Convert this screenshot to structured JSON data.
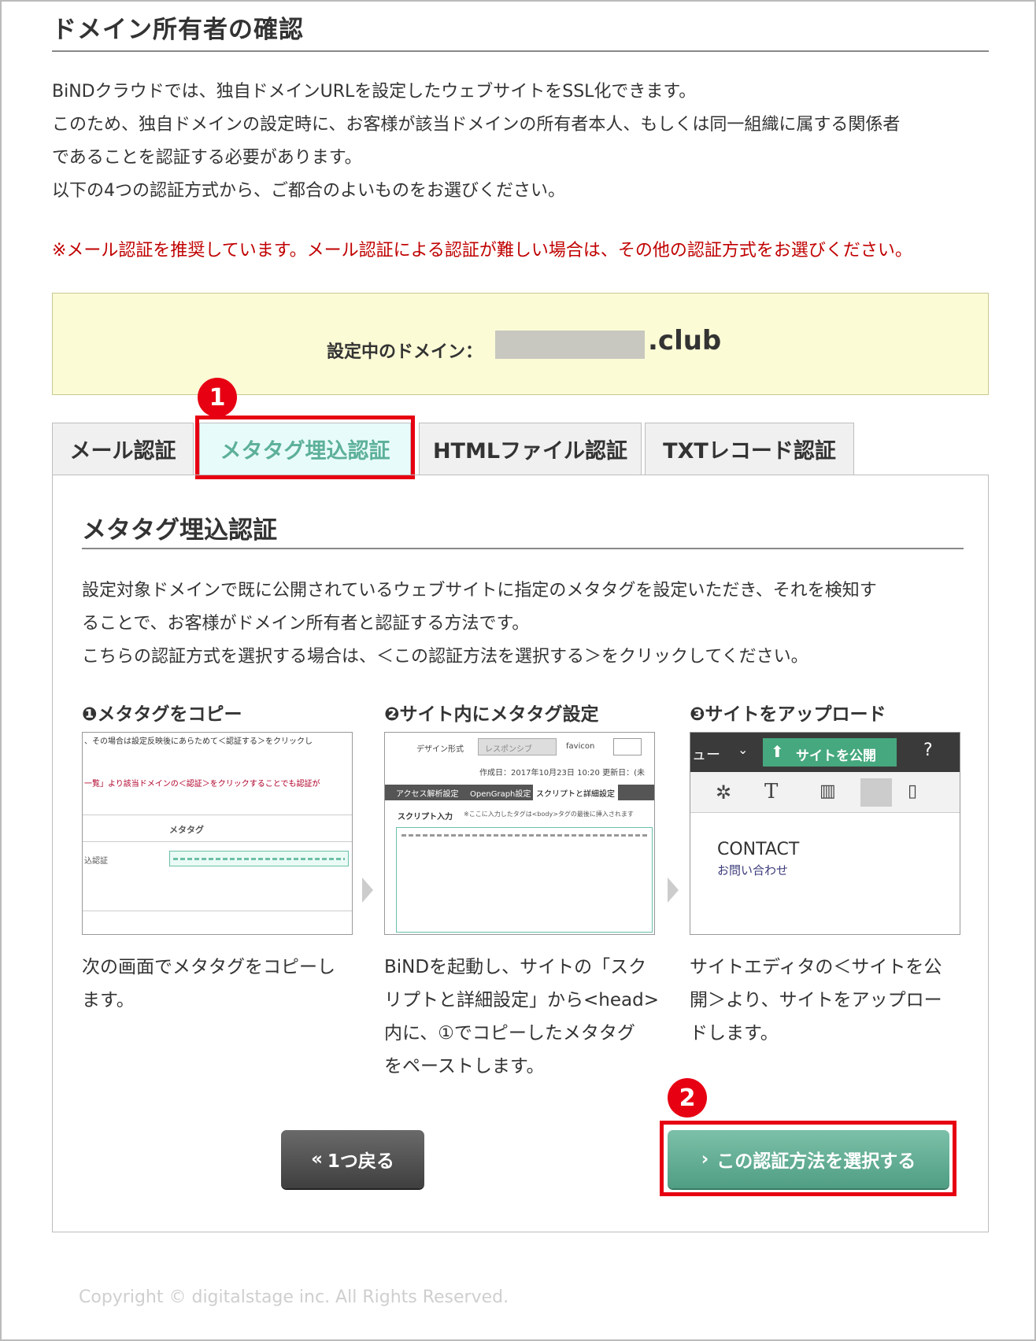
{
  "page": {
    "title": "ドメイン所有者の確認",
    "intro": [
      "BiNDクラウドでは、独自ドメインURLを設定したウェブサイトをSSL化できます。",
      "このため、独自ドメインの設定時に、お客様が該当ドメインの所有者本人、もしくは同一組織に属する関係者",
      "であることを認証する必要があります。",
      "以下の4つの認証方式から、ご都合のよいものをお選びください。"
    ],
    "warning": "※メール認証を推奨しています。メール認証による認証が難しい場合は、その他の認証方式をお選びください。"
  },
  "domain": {
    "label": "設定中のドメイン：",
    "suffix": ".club"
  },
  "markers": {
    "first": "1",
    "second": "2"
  },
  "tabs": [
    {
      "label": "メール認証"
    },
    {
      "label": "メタタグ埋込認証",
      "active": true
    },
    {
      "label": "HTMLファイル認証"
    },
    {
      "label": "TXTレコード認証"
    }
  ],
  "panel": {
    "title": "メタタグ埋込認証",
    "desc": [
      "設定対象ドメインで既に公開されているウェブサイトに指定のメタタグを設定いただき、それを検知す",
      "ることで、お客様がドメイン所有者と認証する方法です。",
      "こちらの認証方式を選択する場合は、＜この認証方法を選択する＞をクリックしてください。"
    ],
    "steps": [
      {
        "title": "❶メタタグをコピー",
        "desc": [
          "次の画面でメタタグをコピーし",
          "ます。"
        ],
        "shot": {
          "line1": "、その場合は設定反映後にあらためて＜認証する＞をクリックし",
          "line2": "一覧」より該当ドメインの＜認証＞をクリックすることでも認証が",
          "col": "メタタグ",
          "row": "込認証"
        }
      },
      {
        "title": "❷サイト内にメタタグ設定",
        "desc": [
          "BiNDを起動し、サイトの「スク",
          "リプトと詳細設定」から<head>",
          "内に、①でコピーしたメタタグ",
          "をペーストします。"
        ],
        "shot": {
          "design": "デザイン形式",
          "responsive": "レスポンシブ",
          "favicon": "favicon",
          "date": "作成日：2017年10月23日 10:20 更新日：(未",
          "tabs": [
            "アクセス解析設定",
            "OpenGraph設定",
            "スクリプトと詳細設定"
          ],
          "script_label": "スクリプト入力",
          "script_hint": "※ここに入力したタグは<body>タグの最後に挿入されます"
        }
      },
      {
        "title": "❸サイトをアップロード",
        "desc": [
          "サイトエディタの＜サイトを公",
          "開＞より、サイトをアップロー",
          "ドします。"
        ],
        "shot": {
          "menu": "ュー",
          "publish": "サイトを公開",
          "contact": "CONTACT",
          "contact_sub": "お問い合わせ"
        }
      }
    ]
  },
  "buttons": {
    "back": "1つ戻る",
    "select": "この認証方法を選択する"
  },
  "colors": {
    "accent_red": "#e60012",
    "warning_red": "#c00000",
    "teal_button": "#5ba78e",
    "domain_bg": "#fbfbd6"
  },
  "copyright": "Copyright © digitalstage inc. All Rights Reserved."
}
